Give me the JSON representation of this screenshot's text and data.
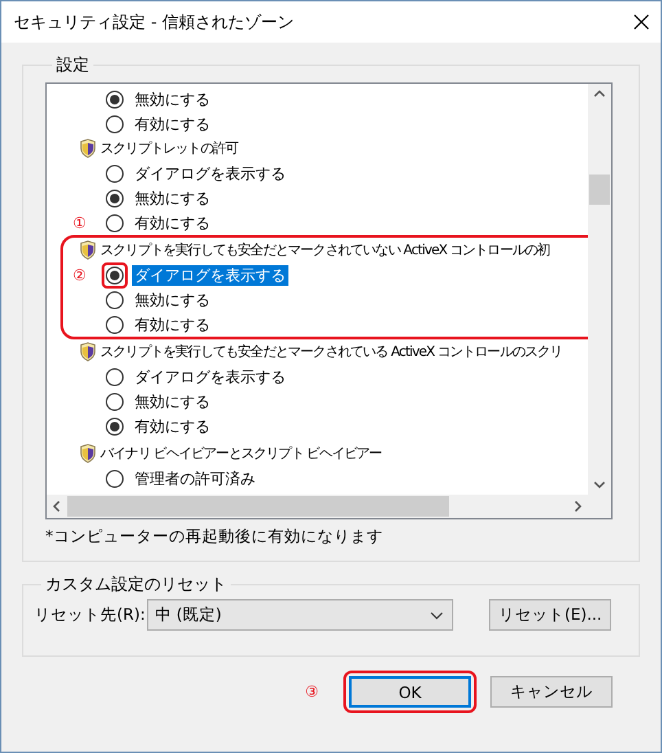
{
  "window": {
    "title": "セキュリティ設定 - 信頼されたゾーン"
  },
  "settings": {
    "label": "設定",
    "items": [
      {
        "kind": "option",
        "label": "無効にする",
        "checked": true,
        "selected": false,
        "boxed": false
      },
      {
        "kind": "option",
        "label": "有効にする",
        "checked": false,
        "selected": false,
        "boxed": false
      },
      {
        "kind": "category",
        "label": "スクリプトレットの許可",
        "highlighted": false,
        "children": [
          {
            "label": "ダイアログを表示する",
            "checked": false,
            "selected": false,
            "boxed": false
          },
          {
            "label": "無効にする",
            "checked": true,
            "selected": false,
            "boxed": false
          },
          {
            "label": "有効にする",
            "checked": false,
            "selected": false,
            "boxed": false,
            "marker": "①"
          }
        ]
      },
      {
        "kind": "category",
        "label": "スクリプトを実行しても安全だとマークされていない ActiveX コントロールの初",
        "highlighted": true,
        "children": [
          {
            "label": "ダイアログを表示する",
            "checked": true,
            "selected": true,
            "boxed": true,
            "marker": "②"
          },
          {
            "label": "無効にする",
            "checked": false,
            "selected": false,
            "boxed": false
          },
          {
            "label": "有効にする",
            "checked": false,
            "selected": false,
            "boxed": false
          }
        ]
      },
      {
        "kind": "category",
        "label": "スクリプトを実行しても安全だとマークされている ActiveX コントロールのスクリ",
        "highlighted": false,
        "children": [
          {
            "label": "ダイアログを表示する",
            "checked": false,
            "selected": false,
            "boxed": false
          },
          {
            "label": "無効にする",
            "checked": false,
            "selected": false,
            "boxed": false
          },
          {
            "label": "有効にする",
            "checked": true,
            "selected": false,
            "boxed": false
          }
        ]
      },
      {
        "kind": "category",
        "label": "バイナリ ビヘイビアーとスクリプト ビヘイビアー",
        "highlighted": false,
        "children": [
          {
            "label": "管理者の許可済み",
            "checked": false,
            "selected": false,
            "boxed": false
          }
        ]
      }
    ],
    "note": "*コンピューターの再起動後に有効になります"
  },
  "reset": {
    "label": "カスタム設定のリセット",
    "field_label": "リセット先(R):",
    "value": "中 (既定)",
    "button": "リセット(E)..."
  },
  "buttons": [
    {
      "label": "OK",
      "default": true,
      "boxed": true,
      "marker": "③"
    },
    {
      "label": "キャンセル",
      "default": false,
      "boxed": false
    }
  ]
}
